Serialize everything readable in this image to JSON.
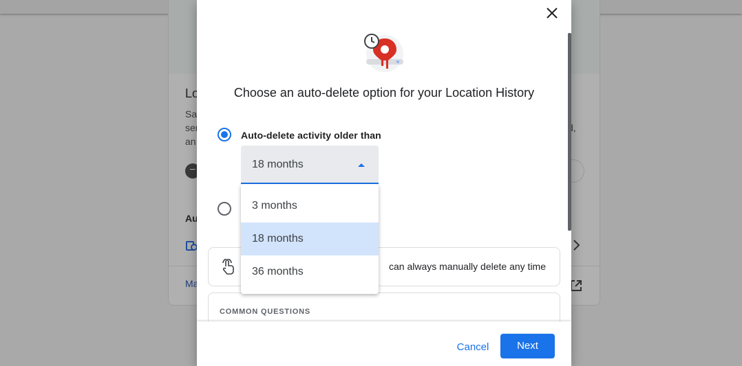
{
  "background": {
    "card_title": "Lo",
    "card_text_lines": [
      "Sa",
      "ser",
      "an"
    ],
    "card_text_right": "d,",
    "section_label": "Au",
    "link_label": "Ma"
  },
  "dialog": {
    "title": "Choose an auto-delete option for your Location History",
    "close_label": "Close",
    "option_auto_delete_label": "Auto-delete activity older than",
    "selected_period": "18 months",
    "period_options": [
      "3 months",
      "18 months",
      "36 months"
    ],
    "info_text": "can always manually delete any time",
    "common_questions_title": "COMMON QUESTIONS",
    "cancel_label": "Cancel",
    "next_label": "Next"
  },
  "colors": {
    "accent": "#1a73e8",
    "selected_option_bg": "#d2e3fc",
    "illustration_red": "#d93025"
  },
  "icons": {
    "close": "close-icon",
    "illustration": "location-history-clock-pin-icon",
    "info": "hand-tap-icon",
    "caret": "caret-up-icon"
  }
}
